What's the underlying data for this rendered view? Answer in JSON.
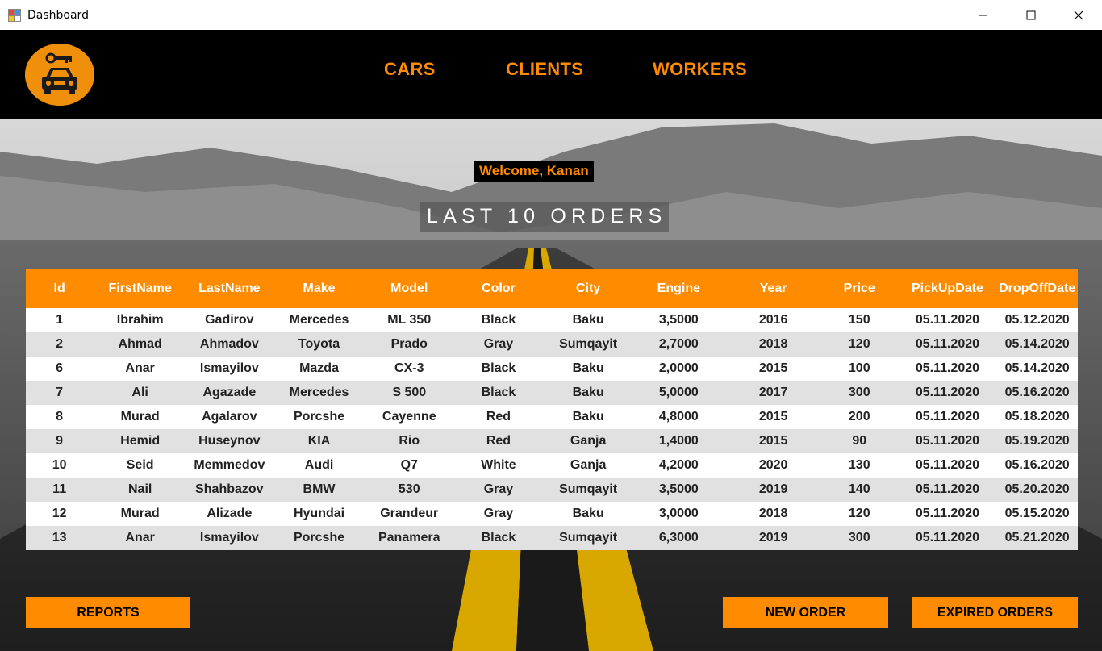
{
  "window": {
    "title": "Dashboard"
  },
  "header": {
    "logo_icon": "car-key-icon",
    "nav": {
      "cars": "CARS",
      "clients": "CLIENTS",
      "workers": "WORKERS"
    }
  },
  "welcome_text": "Welcome, Kanan",
  "orders_title": "LAST 10 ORDERS",
  "table": {
    "columns": [
      "Id",
      "FirstName",
      "LastName",
      "Make",
      "Model",
      "Color",
      "City",
      "Engine",
      "Year",
      "Price",
      "PickUpDate",
      "DropOffDate"
    ],
    "rows": [
      [
        "1",
        "Ibrahim",
        "Gadirov",
        "Mercedes",
        "ML 350",
        "Black",
        "Baku",
        "3,5000",
        "2016",
        "150",
        "05.11.2020",
        "05.12.2020"
      ],
      [
        "2",
        "Ahmad",
        "Ahmadov",
        "Toyota",
        "Prado",
        "Gray",
        "Sumqayit",
        "2,7000",
        "2018",
        "120",
        "05.11.2020",
        "05.14.2020"
      ],
      [
        "6",
        "Anar",
        "Ismayilov",
        "Mazda",
        "CX-3",
        "Black",
        "Baku",
        "2,0000",
        "2015",
        "100",
        "05.11.2020",
        "05.14.2020"
      ],
      [
        "7",
        "Ali",
        "Agazade",
        "Mercedes",
        "S 500",
        "Black",
        "Baku",
        "5,0000",
        "2017",
        "300",
        "05.11.2020",
        "05.16.2020"
      ],
      [
        "8",
        "Murad",
        "Agalarov",
        "Porcshe",
        "Cayenne",
        "Red",
        "Baku",
        "4,8000",
        "2015",
        "200",
        "05.11.2020",
        "05.18.2020"
      ],
      [
        "9",
        "Hemid",
        "Huseynov",
        "KIA",
        "Rio",
        "Red",
        "Ganja",
        "1,4000",
        "2015",
        "90",
        "05.11.2020",
        "05.19.2020"
      ],
      [
        "10",
        "Seid",
        "Memmedov",
        "Audi",
        "Q7",
        "White",
        "Ganja",
        "4,2000",
        "2020",
        "130",
        "05.11.2020",
        "05.16.2020"
      ],
      [
        "11",
        "Nail",
        "Shahbazov",
        "BMW",
        "530",
        "Gray",
        "Sumqayit",
        "3,5000",
        "2019",
        "140",
        "05.11.2020",
        "05.20.2020"
      ],
      [
        "12",
        "Murad",
        "Alizade",
        "Hyundai",
        "Grandeur",
        "Gray",
        "Baku",
        "3,0000",
        "2018",
        "120",
        "05.11.2020",
        "05.15.2020"
      ],
      [
        "13",
        "Anar",
        "Ismayilov",
        "Porcshe",
        "Panamera",
        "Black",
        "Sumqayit",
        "6,3000",
        "2019",
        "300",
        "05.11.2020",
        "05.21.2020"
      ]
    ]
  },
  "buttons": {
    "reports": "REPORTS",
    "new_order": "NEW ORDER",
    "expired_orders": "EXPIRED ORDERS"
  },
  "colors": {
    "accent": "#ff8c00",
    "header_bg": "#000000",
    "row_alt": "#e1e1e1"
  }
}
